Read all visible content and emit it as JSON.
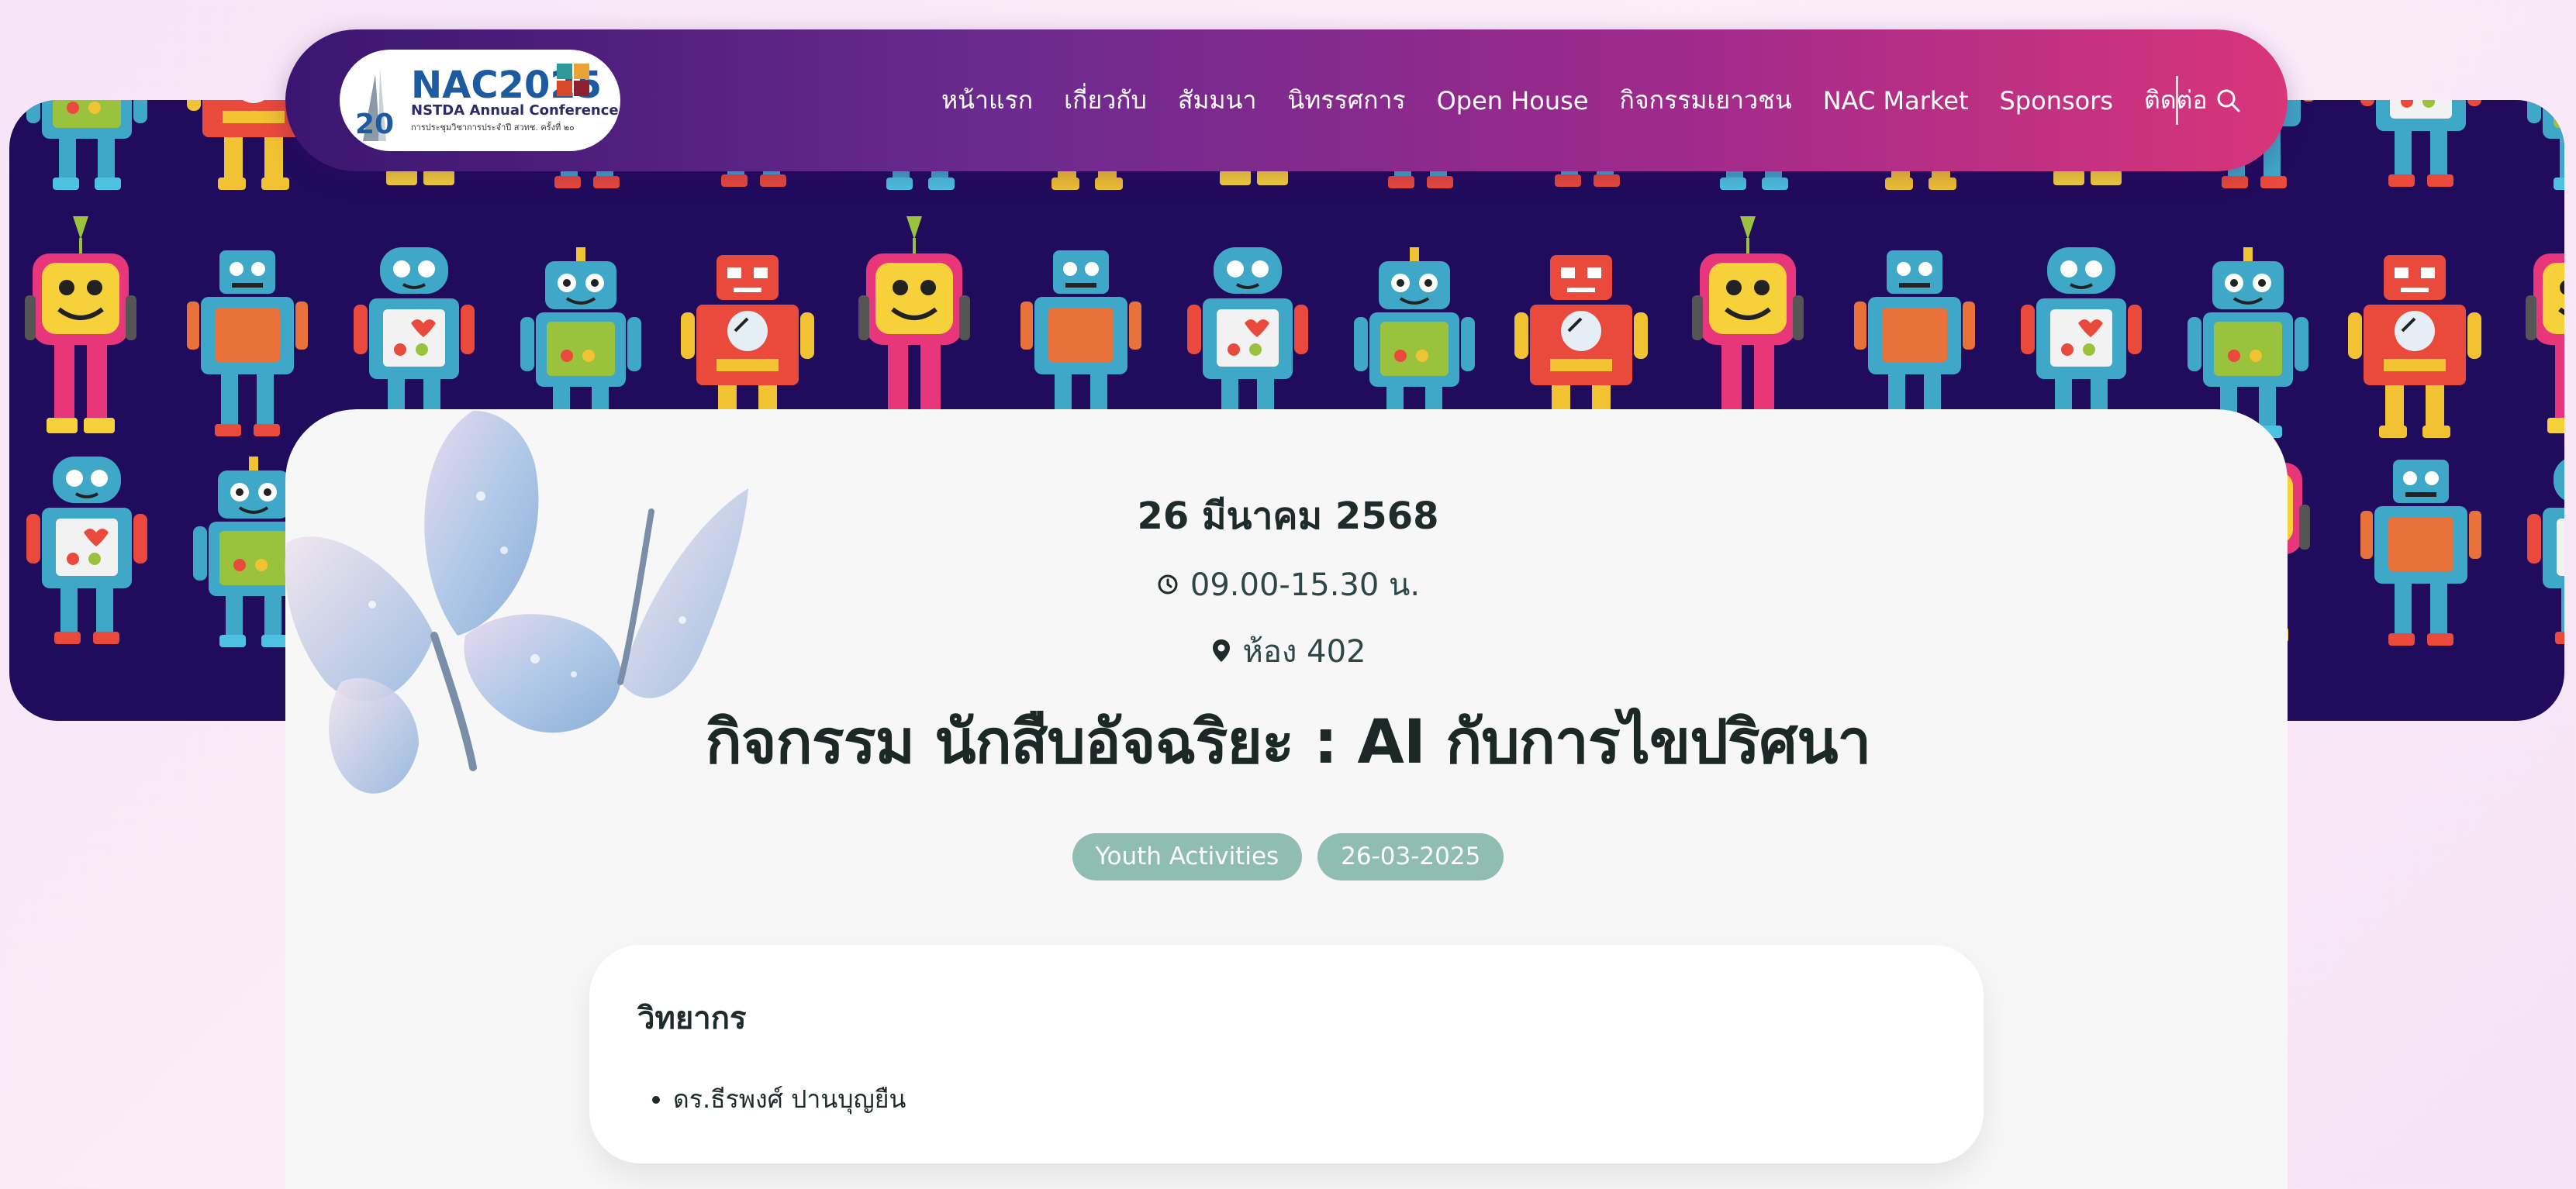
{
  "header": {
    "logo": {
      "title": "NAC2025",
      "edition": "20",
      "subtitle": "NSTDA Annual Conference",
      "tagline": "การประชุมวิชาการประจำปี สวทช. ครั้งที่ ๒๐"
    },
    "nav": [
      {
        "label": "หน้าแรก"
      },
      {
        "label": "เกี่ยวกับ"
      },
      {
        "label": "สัมมนา"
      },
      {
        "label": "นิทรรศการ"
      },
      {
        "label": "Open House"
      },
      {
        "label": "กิจกรรมเยาวชน"
      },
      {
        "label": "NAC Market"
      },
      {
        "label": "Sponsors"
      },
      {
        "label": "ติดต่อ"
      }
    ],
    "search_icon": "search-icon"
  },
  "banner": {
    "pattern": "robot-pattern",
    "background": "#200b5d"
  },
  "event": {
    "date": "26 มีนาคม 2568",
    "time": "09.00-15.30 น.",
    "room": "ห้อง 402",
    "title": "กิจกรรม นักสืบอัจฉริยะ : AI กับการไขปริศนา",
    "tags": [
      {
        "label": "Youth Activities"
      },
      {
        "label": "26-03-2025"
      }
    ]
  },
  "speakers": {
    "heading": "วิทยากร",
    "items": [
      {
        "name": "ดร.ธีรพงศ์ ปานบุญยืน"
      }
    ]
  },
  "colors": {
    "header_gradient_start": "#3b1670",
    "header_gradient_end": "#d8357a",
    "tag_bg": "#8fbdb2",
    "title_text": "#1b2826"
  }
}
